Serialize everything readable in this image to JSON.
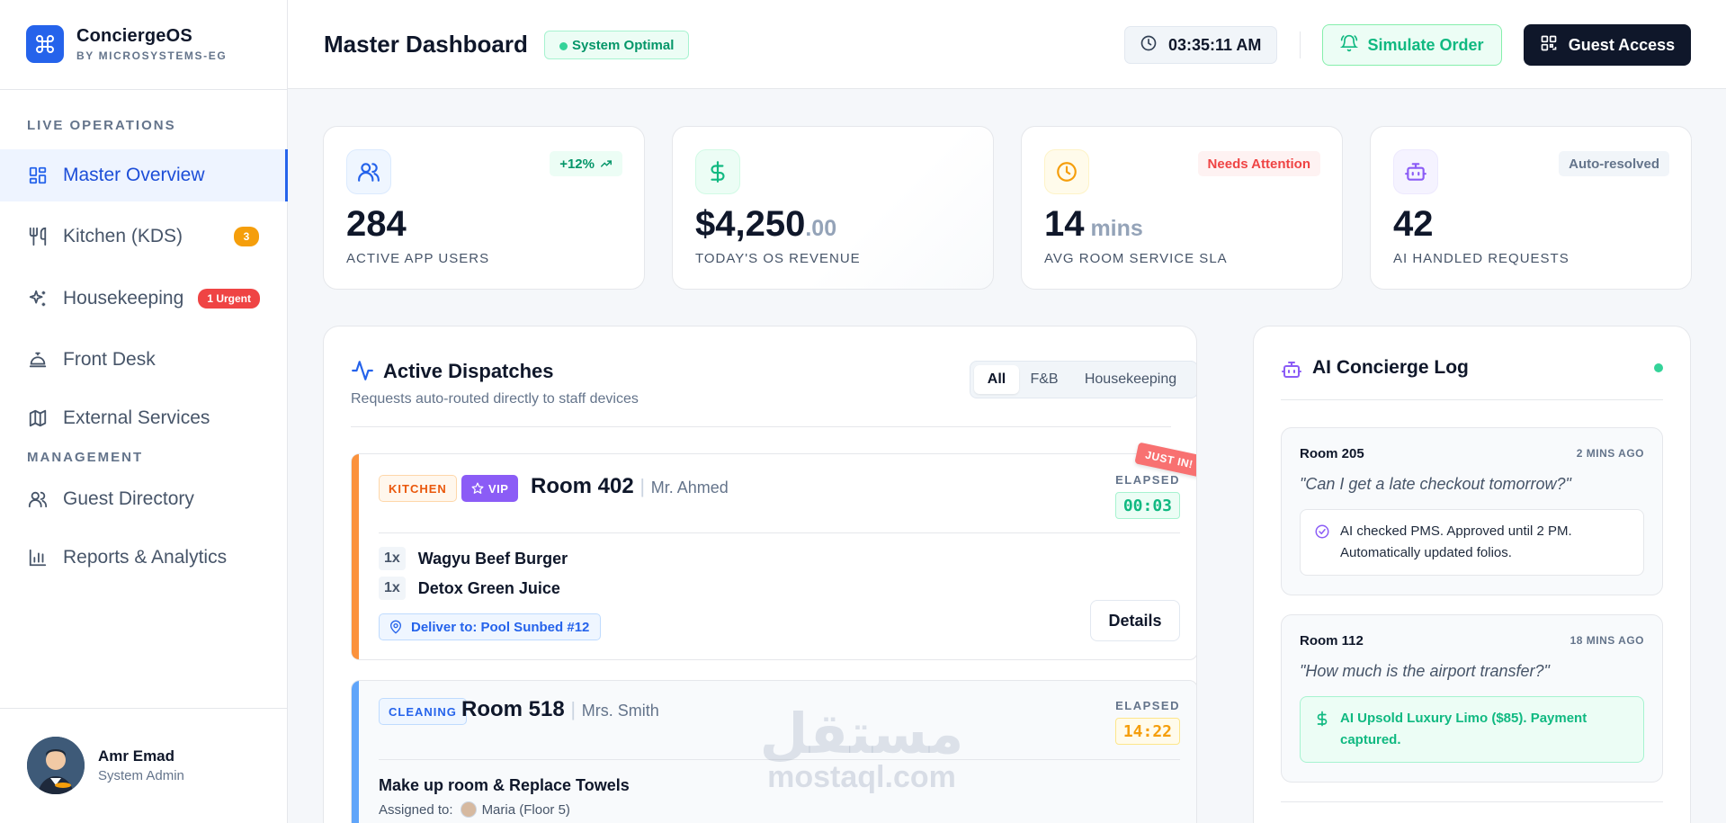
{
  "brand": {
    "name": "ConciergeOS",
    "subtitle": "BY MICROSYSTEMS-EG"
  },
  "sidebar": {
    "sections": {
      "live": "LIVE OPERATIONS",
      "management": "MANAGEMENT"
    },
    "items": [
      {
        "label": "Master Overview",
        "icon": "dashboard-icon",
        "active": true
      },
      {
        "label": "Kitchen (KDS)",
        "icon": "utensils-icon",
        "badge": "3"
      },
      {
        "label": "Housekeeping",
        "icon": "sparkles-icon",
        "badge": "1 Urgent"
      },
      {
        "label": "Front Desk",
        "icon": "bell-concierge-icon"
      },
      {
        "label": "External Services",
        "icon": "map-icon"
      },
      {
        "label": "Guest Directory",
        "icon": "users-icon"
      },
      {
        "label": "Reports & Analytics",
        "icon": "bar-chart-icon"
      }
    ],
    "user": {
      "name": "Amr Emad",
      "role": "System Admin"
    }
  },
  "header": {
    "title": "Master Dashboard",
    "status": "System Optimal",
    "clock": "03:35:11 AM",
    "simulate_label": "Simulate Order",
    "guest_label": "Guest Access"
  },
  "stats": [
    {
      "value": "284",
      "suffix": "",
      "label": "ACTIVE APP USERS",
      "tag": "+12%",
      "icon": "users-icon"
    },
    {
      "value": "$4,250",
      "suffix": ".00",
      "label": "TODAY'S OS REVENUE",
      "tag": "",
      "icon": "dollar-icon"
    },
    {
      "value": "14",
      "suffix": " mins",
      "label": "AVG ROOM SERVICE SLA",
      "tag": "Needs Attention",
      "icon": "clock-icon"
    },
    {
      "value": "42",
      "suffix": "",
      "label": "AI HANDLED REQUESTS",
      "tag": "Auto-resolved",
      "icon": "robot-icon"
    }
  ],
  "dispatches": {
    "title": "Active Dispatches",
    "subtitle": "Requests auto-routed directly to staff devices",
    "filters": [
      "All",
      "F&B",
      "Housekeeping"
    ],
    "active_filter": "All",
    "orders": [
      {
        "category": "KITCHEN",
        "vip": "VIP",
        "room": "Room 402",
        "guest": "Mr. Ahmed",
        "elapsed_label": "ELAPSED",
        "elapsed": "00:03",
        "ribbon": "JUST IN!",
        "items": [
          {
            "qty": "1x",
            "name": "Wagyu Beef Burger"
          },
          {
            "qty": "1x",
            "name": "Detox Green Juice"
          }
        ],
        "deliver": "Deliver to: Pool Sunbed #12",
        "details_label": "Details"
      },
      {
        "category": "CLEANING",
        "room": "Room 518",
        "guest": "Mrs. Smith",
        "elapsed_label": "ELAPSED",
        "elapsed": "14:22",
        "task": "Make up room & Replace Towels",
        "assigned_label": "Assigned to:",
        "assignee": "Maria (Floor 5)"
      }
    ]
  },
  "ai_log": {
    "title": "AI Concierge Log",
    "entries": [
      {
        "room": "Room 205",
        "time": "2 MINS AGO",
        "quote": "\"Can I get a late checkout tomorrow?\"",
        "reply": "AI checked PMS. Approved until 2 PM. Automatically updated folios."
      },
      {
        "room": "Room 112",
        "time": "18 MINS AGO",
        "quote": "\"How much is the airport transfer?\"",
        "reply": "AI Upsold Luxury Limo ($85). Payment captured."
      }
    ]
  },
  "watermark": {
    "arabic": "مستقل",
    "latin": "mostaql.com"
  },
  "colors": {
    "primary": "#2563eb",
    "success": "#10b981",
    "danger": "#ef4444",
    "warning": "#f59e0b",
    "purple": "#8b5cf6",
    "dark": "#0f172a"
  }
}
